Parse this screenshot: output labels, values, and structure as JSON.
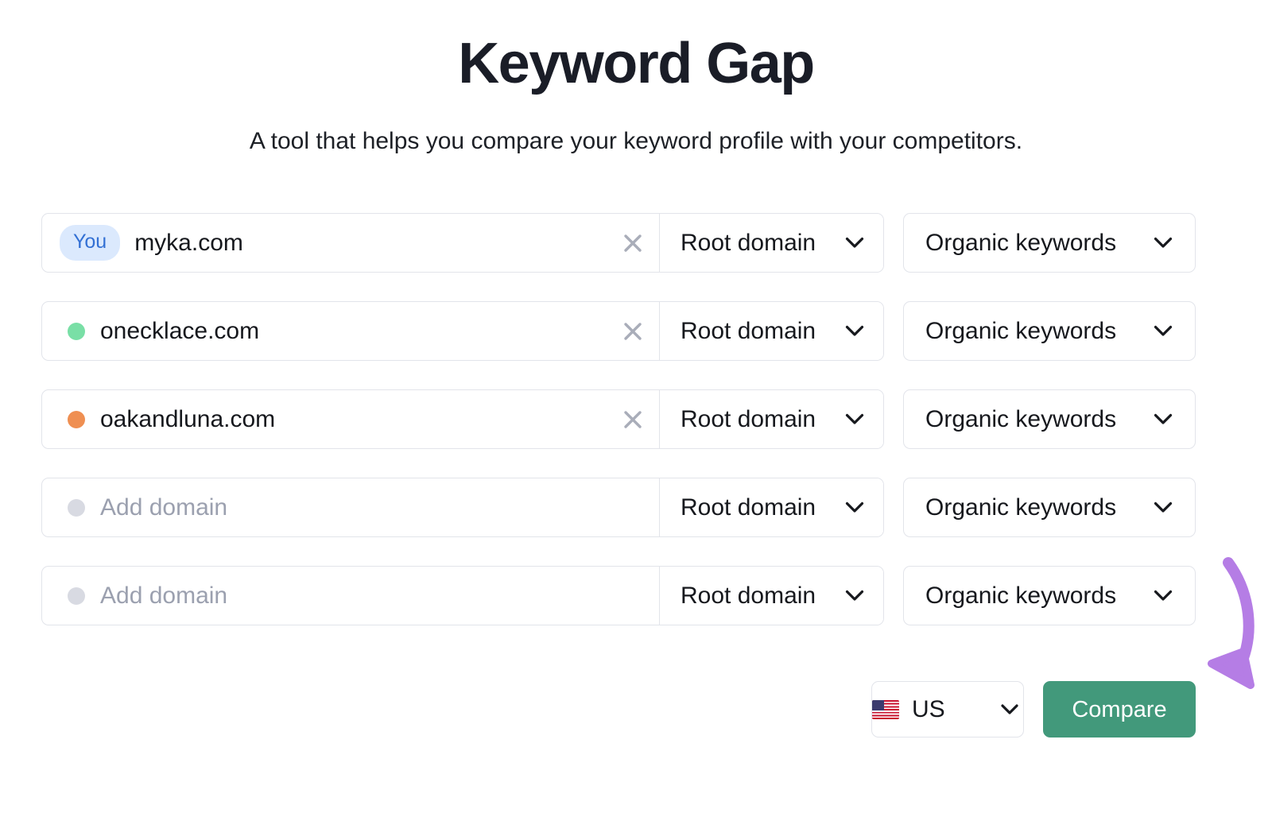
{
  "header": {
    "title": "Keyword Gap",
    "subtitle": "A tool that helps you compare your keyword profile with your competitors."
  },
  "rows": [
    {
      "badge_label": "You",
      "dot_color": "",
      "domain": "myka.com",
      "is_placeholder": false,
      "clear_icon": "close-icon",
      "scope_label": "Root domain",
      "metric_label": "Organic keywords"
    },
    {
      "badge_label": "",
      "dot_color": "#79dfa6",
      "domain": "onecklace.com",
      "is_placeholder": false,
      "clear_icon": "close-icon",
      "scope_label": "Root domain",
      "metric_label": "Organic keywords"
    },
    {
      "badge_label": "",
      "dot_color": "#ef8f52",
      "domain": "oakandluna.com",
      "is_placeholder": false,
      "clear_icon": "close-icon",
      "scope_label": "Root domain",
      "metric_label": "Organic keywords"
    },
    {
      "badge_label": "",
      "dot_color": "#d8dae2",
      "domain": "Add domain",
      "is_placeholder": true,
      "clear_icon": "",
      "scope_label": "Root domain",
      "metric_label": "Organic keywords"
    },
    {
      "badge_label": "",
      "dot_color": "#d8dae2",
      "domain": "Add domain",
      "is_placeholder": true,
      "clear_icon": "",
      "scope_label": "Root domain",
      "metric_label": "Organic keywords"
    }
  ],
  "actions": {
    "country_code": "US",
    "country_flag": "🇺🇸",
    "compare_label": "Compare"
  },
  "annotation": {
    "type": "curved-arrow",
    "color": "#b57de5",
    "points_to": "compare-button"
  },
  "colors": {
    "title": "#1a1d27",
    "badge_bg": "#dbe9fd",
    "badge_text": "#3370d4",
    "border": "#e2e4ea",
    "placeholder_text": "#9ba0af",
    "clear_icon": "#a9adb9",
    "compare_bg": "#42997b",
    "compare_text": "#ffffff",
    "dot_green": "#79dfa6",
    "dot_orange": "#ef8f52",
    "dot_gray": "#d8dae2",
    "arrow": "#b57de5"
  }
}
